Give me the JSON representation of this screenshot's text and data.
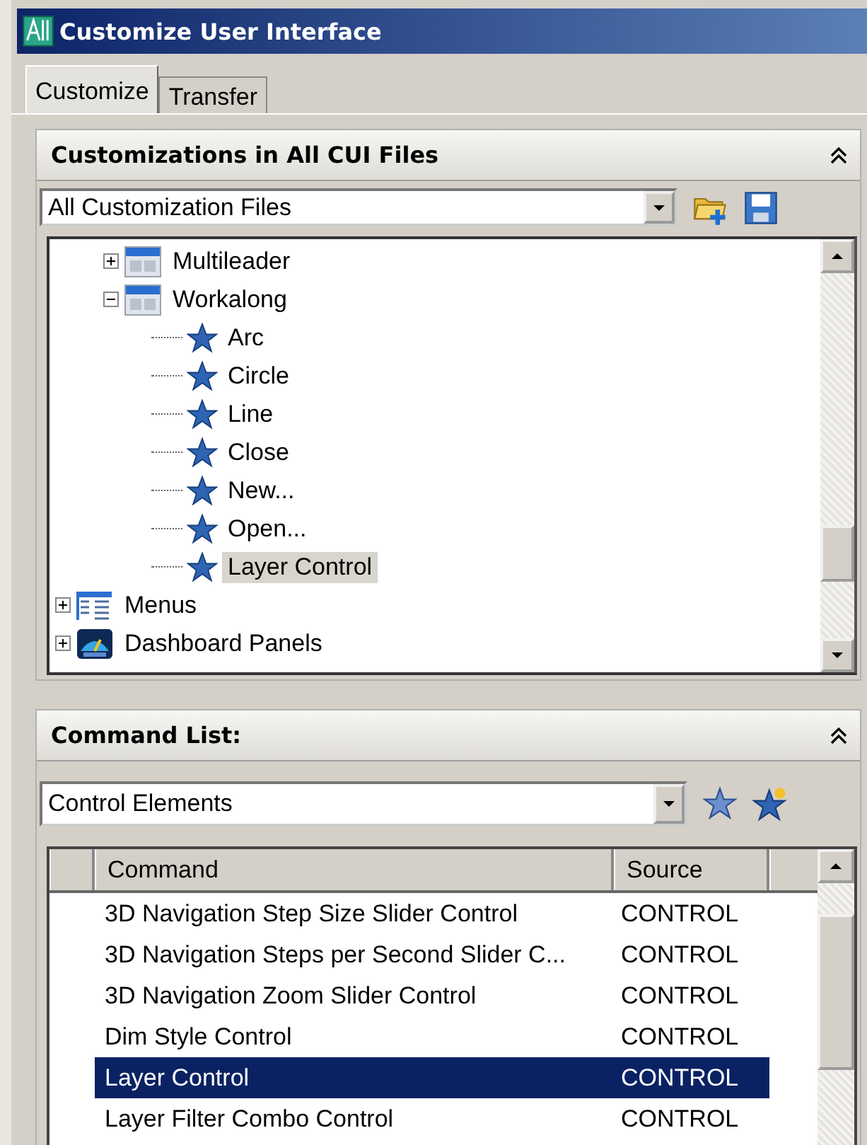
{
  "window": {
    "title": "Customize User Interface"
  },
  "tabs": [
    {
      "label": "Customize",
      "selected": true
    },
    {
      "label": "Transfer",
      "selected": false
    }
  ],
  "customizations": {
    "title": "Customizations in All CUI Files",
    "file_select": {
      "value": "All Customization Files"
    },
    "tree": [
      {
        "children": [
          {
            "label": "Multileader",
            "kind": "toolbar",
            "expanded": false,
            "selected": false
          },
          {
            "label": "Workalong",
            "kind": "toolbar",
            "expanded": true,
            "selected": false,
            "children": [
              {
                "label": "Arc",
                "kind": "command",
                "selected": false
              },
              {
                "label": "Circle",
                "kind": "command",
                "selected": false
              },
              {
                "label": "Line",
                "kind": "command",
                "selected": false
              },
              {
                "label": "Close",
                "kind": "command",
                "selected": false
              },
              {
                "label": "New...",
                "kind": "command",
                "selected": false
              },
              {
                "label": "Open...",
                "kind": "command",
                "selected": false
              },
              {
                "label": "Layer Control",
                "kind": "command",
                "selected": true
              }
            ]
          }
        ]
      },
      {
        "label": "Menus",
        "kind": "menu",
        "expanded": false,
        "selected": false
      },
      {
        "label": "Dashboard Panels",
        "kind": "dashboard",
        "expanded": false,
        "selected": false
      }
    ]
  },
  "command_list": {
    "title": "Command List:",
    "filter_select": {
      "value": "Control Elements"
    },
    "columns": [
      "Command",
      "Source"
    ],
    "rows": [
      {
        "command": "3D Navigation Step Size Slider Control",
        "source": "CONTROL",
        "selected": false
      },
      {
        "command": "3D Navigation Steps per Second Slider C...",
        "source": "CONTROL",
        "selected": false
      },
      {
        "command": "3D Navigation Zoom Slider Control",
        "source": "CONTROL",
        "selected": false
      },
      {
        "command": "Dim Style Control",
        "source": "CONTROL",
        "selected": false
      },
      {
        "command": "Layer Control",
        "source": "CONTROL",
        "selected": true
      },
      {
        "command": "Layer Filter Combo Control",
        "source": "CONTROL",
        "selected": false
      }
    ]
  }
}
